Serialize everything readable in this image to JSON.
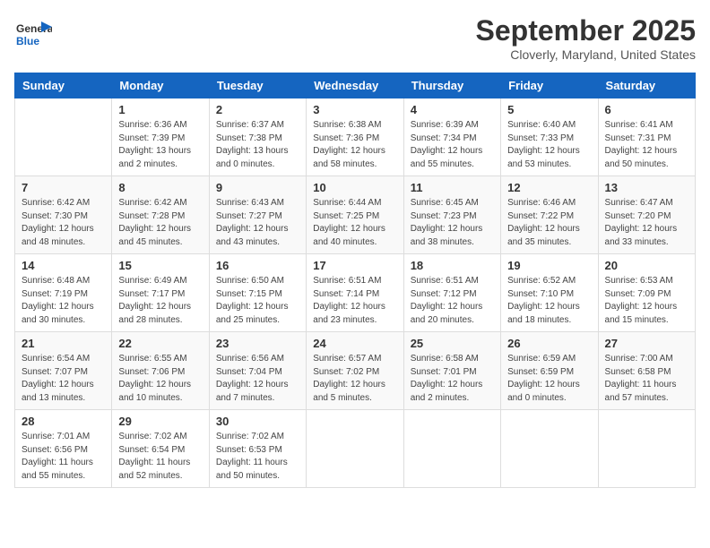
{
  "header": {
    "logo_general": "General",
    "logo_blue": "Blue",
    "month": "September 2025",
    "location": "Cloverly, Maryland, United States"
  },
  "weekdays": [
    "Sunday",
    "Monday",
    "Tuesday",
    "Wednesday",
    "Thursday",
    "Friday",
    "Saturday"
  ],
  "weeks": [
    [
      {
        "day": "",
        "info": ""
      },
      {
        "day": "1",
        "info": "Sunrise: 6:36 AM\nSunset: 7:39 PM\nDaylight: 13 hours\nand 2 minutes."
      },
      {
        "day": "2",
        "info": "Sunrise: 6:37 AM\nSunset: 7:38 PM\nDaylight: 13 hours\nand 0 minutes."
      },
      {
        "day": "3",
        "info": "Sunrise: 6:38 AM\nSunset: 7:36 PM\nDaylight: 12 hours\nand 58 minutes."
      },
      {
        "day": "4",
        "info": "Sunrise: 6:39 AM\nSunset: 7:34 PM\nDaylight: 12 hours\nand 55 minutes."
      },
      {
        "day": "5",
        "info": "Sunrise: 6:40 AM\nSunset: 7:33 PM\nDaylight: 12 hours\nand 53 minutes."
      },
      {
        "day": "6",
        "info": "Sunrise: 6:41 AM\nSunset: 7:31 PM\nDaylight: 12 hours\nand 50 minutes."
      }
    ],
    [
      {
        "day": "7",
        "info": "Sunrise: 6:42 AM\nSunset: 7:30 PM\nDaylight: 12 hours\nand 48 minutes."
      },
      {
        "day": "8",
        "info": "Sunrise: 6:42 AM\nSunset: 7:28 PM\nDaylight: 12 hours\nand 45 minutes."
      },
      {
        "day": "9",
        "info": "Sunrise: 6:43 AM\nSunset: 7:27 PM\nDaylight: 12 hours\nand 43 minutes."
      },
      {
        "day": "10",
        "info": "Sunrise: 6:44 AM\nSunset: 7:25 PM\nDaylight: 12 hours\nand 40 minutes."
      },
      {
        "day": "11",
        "info": "Sunrise: 6:45 AM\nSunset: 7:23 PM\nDaylight: 12 hours\nand 38 minutes."
      },
      {
        "day": "12",
        "info": "Sunrise: 6:46 AM\nSunset: 7:22 PM\nDaylight: 12 hours\nand 35 minutes."
      },
      {
        "day": "13",
        "info": "Sunrise: 6:47 AM\nSunset: 7:20 PM\nDaylight: 12 hours\nand 33 minutes."
      }
    ],
    [
      {
        "day": "14",
        "info": "Sunrise: 6:48 AM\nSunset: 7:19 PM\nDaylight: 12 hours\nand 30 minutes."
      },
      {
        "day": "15",
        "info": "Sunrise: 6:49 AM\nSunset: 7:17 PM\nDaylight: 12 hours\nand 28 minutes."
      },
      {
        "day": "16",
        "info": "Sunrise: 6:50 AM\nSunset: 7:15 PM\nDaylight: 12 hours\nand 25 minutes."
      },
      {
        "day": "17",
        "info": "Sunrise: 6:51 AM\nSunset: 7:14 PM\nDaylight: 12 hours\nand 23 minutes."
      },
      {
        "day": "18",
        "info": "Sunrise: 6:51 AM\nSunset: 7:12 PM\nDaylight: 12 hours\nand 20 minutes."
      },
      {
        "day": "19",
        "info": "Sunrise: 6:52 AM\nSunset: 7:10 PM\nDaylight: 12 hours\nand 18 minutes."
      },
      {
        "day": "20",
        "info": "Sunrise: 6:53 AM\nSunset: 7:09 PM\nDaylight: 12 hours\nand 15 minutes."
      }
    ],
    [
      {
        "day": "21",
        "info": "Sunrise: 6:54 AM\nSunset: 7:07 PM\nDaylight: 12 hours\nand 13 minutes."
      },
      {
        "day": "22",
        "info": "Sunrise: 6:55 AM\nSunset: 7:06 PM\nDaylight: 12 hours\nand 10 minutes."
      },
      {
        "day": "23",
        "info": "Sunrise: 6:56 AM\nSunset: 7:04 PM\nDaylight: 12 hours\nand 7 minutes."
      },
      {
        "day": "24",
        "info": "Sunrise: 6:57 AM\nSunset: 7:02 PM\nDaylight: 12 hours\nand 5 minutes."
      },
      {
        "day": "25",
        "info": "Sunrise: 6:58 AM\nSunset: 7:01 PM\nDaylight: 12 hours\nand 2 minutes."
      },
      {
        "day": "26",
        "info": "Sunrise: 6:59 AM\nSunset: 6:59 PM\nDaylight: 12 hours\nand 0 minutes."
      },
      {
        "day": "27",
        "info": "Sunrise: 7:00 AM\nSunset: 6:58 PM\nDaylight: 11 hours\nand 57 minutes."
      }
    ],
    [
      {
        "day": "28",
        "info": "Sunrise: 7:01 AM\nSunset: 6:56 PM\nDaylight: 11 hours\nand 55 minutes."
      },
      {
        "day": "29",
        "info": "Sunrise: 7:02 AM\nSunset: 6:54 PM\nDaylight: 11 hours\nand 52 minutes."
      },
      {
        "day": "30",
        "info": "Sunrise: 7:02 AM\nSunset: 6:53 PM\nDaylight: 11 hours\nand 50 minutes."
      },
      {
        "day": "",
        "info": ""
      },
      {
        "day": "",
        "info": ""
      },
      {
        "day": "",
        "info": ""
      },
      {
        "day": "",
        "info": ""
      }
    ]
  ]
}
